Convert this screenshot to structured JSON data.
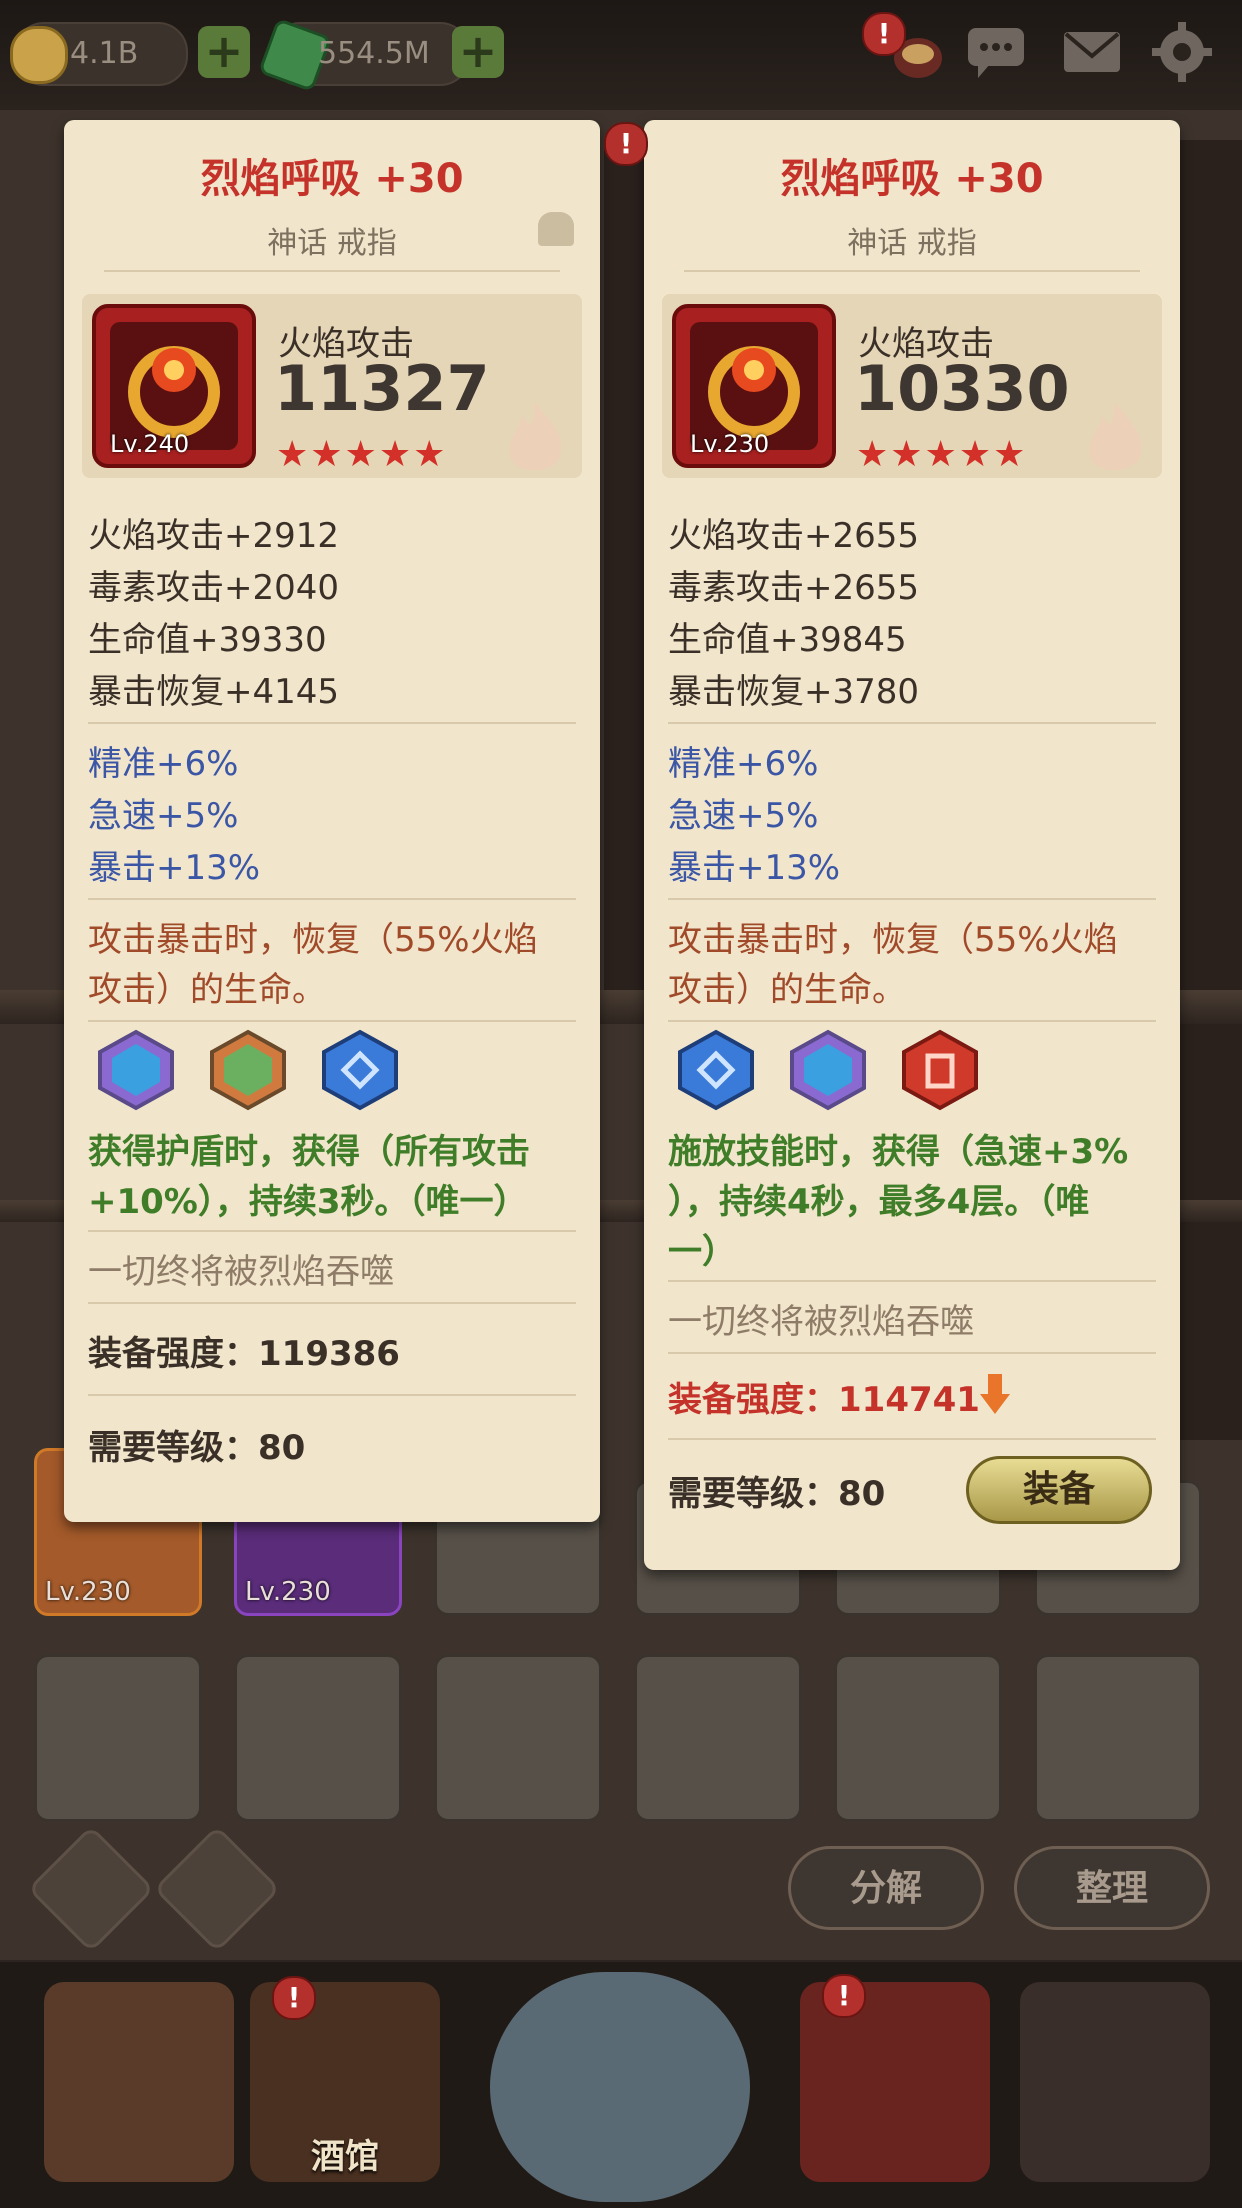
{
  "topbar": {
    "gold": "4.1B",
    "gems": "554.5M",
    "icons": [
      "gold-coin-icon",
      "green-gem-icon",
      "hero-helmet-icon",
      "chat-icon",
      "mail-icon",
      "settings-icon"
    ]
  },
  "bottom": {
    "btn_decompose": "分解",
    "btn_sort": "整理",
    "slot_levels": [
      "Lv.230",
      "Lv.230"
    ]
  },
  "nav": {
    "tavern": "酒馆"
  },
  "left_card": {
    "title": "烈焰呼吸 +30",
    "subtitle": "神话 戒指",
    "level": "Lv.240",
    "main_stat_name": "火焰攻击",
    "main_stat_value": "11327",
    "stars": "★★★★★",
    "stats": [
      "火焰攻击+2912",
      "毒素攻击+2040",
      "生命值+39330",
      "暴击恢复+4145"
    ],
    "bonus": [
      "精准+6%",
      "急速+5%",
      "暴击+13%"
    ],
    "effect": [
      "攻击暴击时，恢复（55%火焰",
      "攻击）的生命。"
    ],
    "set_effect": [
      "获得护盾时，获得（所有攻击",
      "+10%），持续3秒。（唯一）"
    ],
    "flavor": "一切终将被烈焰吞噬",
    "power": "装备强度：119386",
    "req": "需要等级：80"
  },
  "right_card": {
    "title": "烈焰呼吸 +30",
    "subtitle": "神话 戒指",
    "level": "Lv.230",
    "main_stat_name": "火焰攻击",
    "main_stat_value": "10330",
    "stars": "★★★★★",
    "stats": [
      "火焰攻击+2655",
      "毒素攻击+2655",
      "生命值+39845",
      "暴击恢复+3780"
    ],
    "bonus": [
      "精准+6%",
      "急速+5%",
      "暴击+13%"
    ],
    "effect": [
      "攻击暴击时，恢复（55%火焰",
      "攻击）的生命。"
    ],
    "set_effect": [
      "施放技能时，获得（急速+3%",
      "），持续4秒，最多4层。（唯",
      "一）"
    ],
    "flavor": "一切终将被烈焰吞噬",
    "power": "装备强度：114741",
    "req": "需要等级：80",
    "equip_button": "装备"
  },
  "colors": {
    "title_red": "#c4322a",
    "blue_stat": "#3c56a6",
    "green_effect": "#3f7d28",
    "parchment": "#f1e6cc"
  }
}
